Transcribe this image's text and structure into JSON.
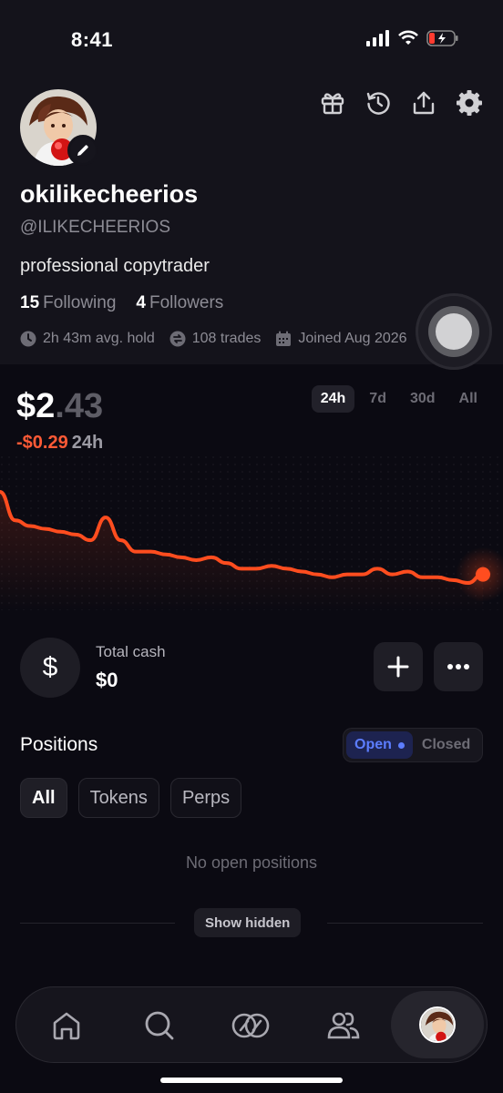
{
  "status_bar": {
    "time": "8:41"
  },
  "profile": {
    "display_name": "okilikecheerios",
    "handle": "@ILIKECHEERIOS",
    "bio": "professional copytrader",
    "following_count": "15",
    "following_label": "Following",
    "followers_count": "4",
    "followers_label": "Followers",
    "stats": {
      "avg_hold": "2h 43m avg. hold",
      "trades": "108 trades",
      "joined": "Joined Aug 2026"
    }
  },
  "portfolio": {
    "balance_main": "$2",
    "balance_cents": ".43",
    "change": "-$0.29",
    "change_period": "24h",
    "ranges": [
      "24h",
      "7d",
      "30d",
      "All"
    ],
    "active_range": "24h"
  },
  "chart_data": {
    "type": "line",
    "series": [
      {
        "values": [
          2.72,
          2.62,
          2.6,
          2.59,
          2.58,
          2.57,
          2.55,
          2.63,
          2.55,
          2.51,
          2.51,
          2.5,
          2.49,
          2.48,
          2.49,
          2.47,
          2.45,
          2.45,
          2.46,
          2.45,
          2.44,
          2.43,
          2.42,
          2.43,
          2.43,
          2.45,
          2.43,
          2.44,
          2.42,
          2.42,
          2.41,
          2.4,
          2.43
        ]
      }
    ],
    "line_color": "#ff4d1f"
  },
  "cash": {
    "label": "Total cash",
    "value": "$0",
    "icon": "$"
  },
  "positions": {
    "title": "Positions",
    "toggle_open": "Open",
    "toggle_closed": "Closed",
    "filters": [
      "All",
      "Tokens",
      "Perps"
    ],
    "empty_text": "No open positions",
    "show_hidden": "Show hidden"
  },
  "nav": [
    "home-icon",
    "search-icon",
    "trade-icon",
    "people-icon",
    "profile-avatar"
  ]
}
